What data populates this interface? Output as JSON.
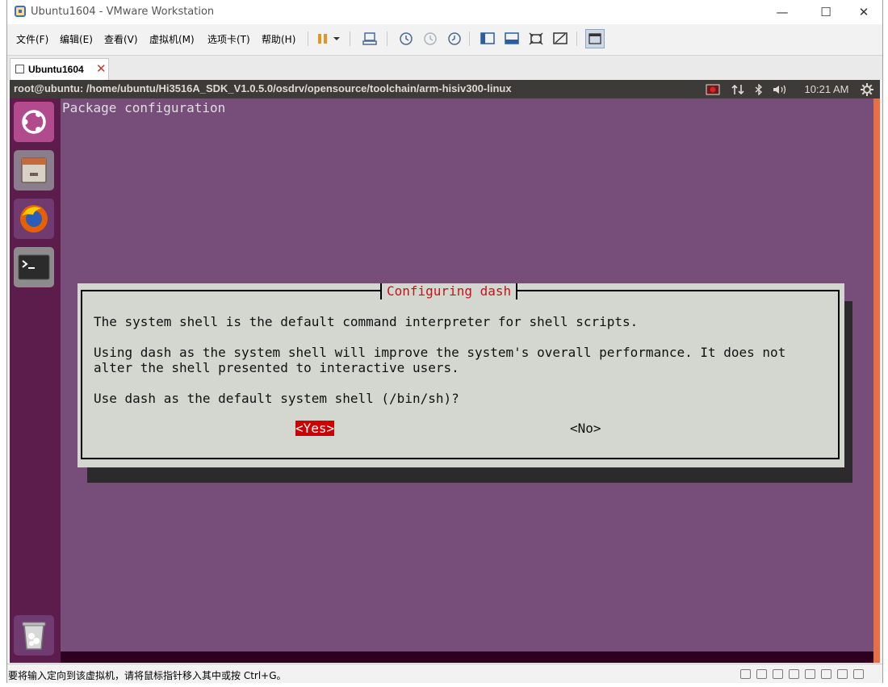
{
  "window": {
    "title": "Ubuntu1604 - VMware Workstation",
    "controls": [
      "—",
      "☐",
      "✕"
    ]
  },
  "menu": [
    "文件(F)",
    "编辑(E)",
    "查看(V)",
    "虚拟机(M)",
    "选项卡(T)",
    "帮助(H)"
  ],
  "tab": {
    "label": "Ubuntu1604",
    "close": "✕"
  },
  "guest": {
    "topbar_title": "root@ubuntu: /home/ubuntu/Hi3516A_SDK_V1.0.5.0/osdrv/opensource/toolchain/arm-hisiv300-linux",
    "clock": "10:21 AM",
    "launcher_icons": [
      "ubuntu-logo-icon",
      "files-icon",
      "firefox-icon",
      "terminal-icon",
      "trash-icon"
    ]
  },
  "terminal": {
    "header": "Package configuration",
    "dialog": {
      "title": "Configuring dash",
      "line1": "The system shell is the default command interpreter for shell scripts.",
      "line2": "Using dash as the system shell will improve the system's overall performance. It does not",
      "line3": "alter the shell presented to interactive users.",
      "question": "Use dash as the default system shell (/bin/sh)?",
      "yes": "<Yes>",
      "no": "<No>"
    }
  },
  "status": {
    "text": "要将输入定向到该虚拟机，请将鼠标指针移入其中或按 Ctrl+G。"
  },
  "colors": {
    "terminal_bg": "#774e7a",
    "launcher_bg": "#5c1d4c",
    "dialog_bg": "#d3d7cf",
    "accent_red": "#cc0000"
  }
}
